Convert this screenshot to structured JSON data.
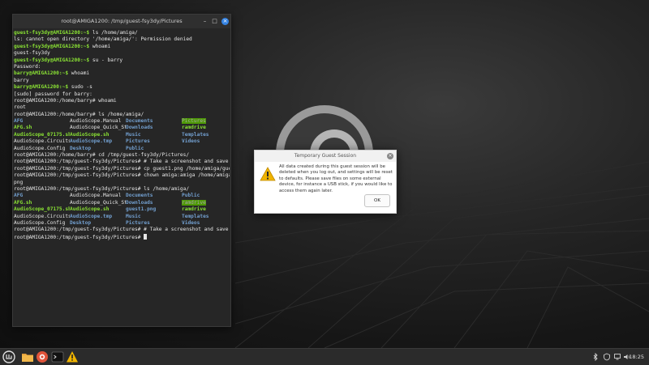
{
  "terminal": {
    "title": "root@AMIGA1200: /tmp/guest-fsy3dy/Pictures",
    "lines": [
      {
        "type": "cmd",
        "prompt": "guest-fsy3dy@AMIGA1200:~$",
        "cmd": " ls /home/amiga/"
      },
      {
        "type": "text",
        "text": "ls: cannot open directory '/home/amiga/': Permission denied"
      },
      {
        "type": "cmd",
        "prompt": "guest-fsy3dy@AMIGA1200:~$",
        "cmd": " whoami"
      },
      {
        "type": "text",
        "text": "guest-fsy3dy"
      },
      {
        "type": "cmd",
        "prompt": "guest-fsy3dy@AMIGA1200:~$",
        "cmd": " su - barry"
      },
      {
        "type": "text",
        "text": "Password:"
      },
      {
        "type": "cmd",
        "prompt": "barry@AMIGA1200:~$",
        "cmd": " whoami"
      },
      {
        "type": "text",
        "text": "barry"
      },
      {
        "type": "cmd",
        "prompt": "barry@AMIGA1200:~$",
        "cmd": " sudo -s"
      },
      {
        "type": "text",
        "text": "[sudo] password for barry:"
      },
      {
        "type": "text",
        "text": "root@AMIGA1200:/home/barry# whoami"
      },
      {
        "type": "text",
        "text": "root"
      },
      {
        "type": "text",
        "text": "root@AMIGA1200:/home/barry# ls /home/amiga/"
      },
      {
        "type": "cols",
        "cells": [
          {
            "t": "AFG",
            "k": "dir"
          },
          {
            "t": "AudioScope.Manual",
            "k": ""
          },
          {
            "t": "Documents",
            "k": "dir"
          },
          {
            "t": "Pictures",
            "k": "hl"
          }
        ]
      },
      {
        "type": "cols",
        "cells": [
          {
            "t": "AFG.sh",
            "k": "exe"
          },
          {
            "t": "AudioScope_Quick_Start.Notes",
            "k": ""
          },
          {
            "t": "Downloads",
            "k": "dir"
          },
          {
            "t": "ramdrive",
            "k": "exe"
          }
        ]
      },
      {
        "type": "cols",
        "cells": [
          {
            "t": "AudioScope_07175.sh",
            "k": "exe"
          },
          {
            "t": "AudioScope.sh",
            "k": "exe"
          },
          {
            "t": "Music",
            "k": "dir"
          },
          {
            "t": "Templates",
            "k": "dir"
          }
        ]
      },
      {
        "type": "cols",
        "cells": [
          {
            "t": "AudioScope.Circuits",
            "k": ""
          },
          {
            "t": "AudioScope.tmp",
            "k": "dir"
          },
          {
            "t": "Pictures",
            "k": "dir"
          },
          {
            "t": "Videos",
            "k": "dir"
          }
        ]
      },
      {
        "type": "cols",
        "cells": [
          {
            "t": "AudioScope.Config",
            "k": ""
          },
          {
            "t": "Desktop",
            "k": "dir"
          },
          {
            "t": "Public",
            "k": "dir"
          },
          {
            "t": "",
            "k": ""
          }
        ]
      },
      {
        "type": "text",
        "text": "root@AMIGA1200:/home/barry# cd /tmp/guest-fsy3dy/Pictures/"
      },
      {
        "type": "text",
        "text": "root@AMIGA1200:/tmp/guest-fsy3dy/Pictures# # Take a screenshot and save..."
      },
      {
        "type": "text",
        "text": "root@AMIGA1200:/tmp/guest-fsy3dy/Pictures# cp guest1.png /home/amiga/guest1.png"
      },
      {
        "type": "text",
        "text": "root@AMIGA1200:/tmp/guest-fsy3dy/Pictures# chown amiga:amiga /home/amiga/guest1."
      },
      {
        "type": "text",
        "text": "png"
      },
      {
        "type": "text",
        "text": "root@AMIGA1200:/tmp/guest-fsy3dy/Pictures# ls /home/amiga/"
      },
      {
        "type": "cols",
        "cells": [
          {
            "t": "AFG",
            "k": "dir"
          },
          {
            "t": "AudioScope.Manual",
            "k": ""
          },
          {
            "t": "Documents",
            "k": "dir"
          },
          {
            "t": "Public",
            "k": "dir"
          }
        ]
      },
      {
        "type": "cols",
        "cells": [
          {
            "t": "AFG.sh",
            "k": "exe"
          },
          {
            "t": "AudioScope_Quick_Start.Notes",
            "k": ""
          },
          {
            "t": "Downloads",
            "k": "dir"
          },
          {
            "t": "ramdrive",
            "k": "hl"
          }
        ]
      },
      {
        "type": "cols",
        "cells": [
          {
            "t": "AudioScope_07175.sh",
            "k": "exe"
          },
          {
            "t": "AudioScope.sh",
            "k": "exe"
          },
          {
            "t": "guest1.png",
            "k": "dir"
          },
          {
            "t": "ramdrive",
            "k": "exe"
          }
        ]
      },
      {
        "type": "cols",
        "cells": [
          {
            "t": "AudioScope.Circuits",
            "k": ""
          },
          {
            "t": "AudioScope.tmp",
            "k": "dir"
          },
          {
            "t": "Music",
            "k": "dir"
          },
          {
            "t": "Templates",
            "k": "dir"
          }
        ]
      },
      {
        "type": "cols",
        "cells": [
          {
            "t": "AudioScope.Config",
            "k": ""
          },
          {
            "t": "Desktop",
            "k": "dir"
          },
          {
            "t": "Pictures",
            "k": "dir"
          },
          {
            "t": "Videos",
            "k": "dir"
          }
        ]
      },
      {
        "type": "text",
        "text": "root@AMIGA1200:/tmp/guest-fsy3dy/Pictures# # Take a screenshot and save..."
      },
      {
        "type": "cursor",
        "text": "root@AMIGA1200:/tmp/guest-fsy3dy/Pictures# "
      }
    ]
  },
  "dialog": {
    "title": "Temporary Guest Session",
    "message": "All data created during this guest session will be deleted when you log out, and settings will be reset to defaults. Please save files on some external device, for instance a USB stick, if you would like to access them again later.",
    "ok_label": "OK",
    "icon": "warning-icon"
  },
  "taskbar": {
    "icons": [
      "menu-icon",
      "files-icon",
      "browser-icon",
      "terminal-icon",
      "warning-icon"
    ],
    "clock": "18:25"
  },
  "colors": {
    "prompt": "#8ae234",
    "directory": "#729fcf",
    "highlight": "#4e9a06",
    "accent": "#3584e4"
  }
}
